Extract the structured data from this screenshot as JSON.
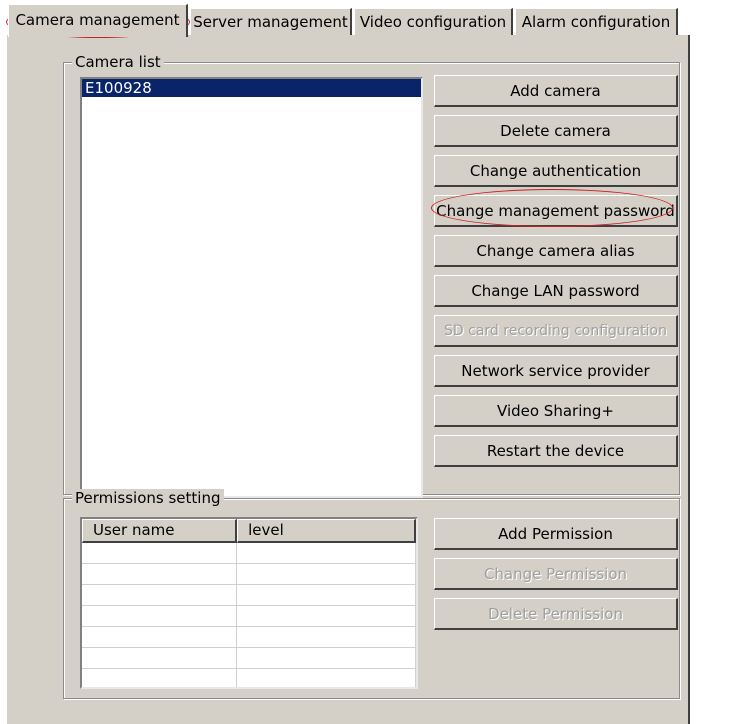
{
  "tabs": [
    {
      "label": "Camera management",
      "active": true
    },
    {
      "label": "Server management",
      "active": false
    },
    {
      "label": "Video configuration",
      "active": false
    },
    {
      "label": "Alarm configuration",
      "active": false
    }
  ],
  "camera_list": {
    "title": "Camera list",
    "items": [
      {
        "label": "E100928",
        "selected": true
      }
    ],
    "buttons": [
      {
        "label": "Add camera",
        "enabled": true
      },
      {
        "label": "Delete camera",
        "enabled": true
      },
      {
        "label": "Change authentication",
        "enabled": true
      },
      {
        "label": "Change management password",
        "enabled": true
      },
      {
        "label": "Change camera alias",
        "enabled": true
      },
      {
        "label": "Change LAN password",
        "enabled": true
      },
      {
        "label": "SD card recording configuration",
        "enabled": false
      },
      {
        "label": "Network service provider",
        "enabled": true
      },
      {
        "label": "Video Sharing+",
        "enabled": true
      },
      {
        "label": "Restart the device",
        "enabled": true
      }
    ]
  },
  "permissions": {
    "title": "Permissions setting",
    "columns": [
      "User name",
      "level"
    ],
    "buttons": [
      {
        "label": "Add Permission",
        "enabled": true
      },
      {
        "label": "Change Permission",
        "enabled": false
      },
      {
        "label": "Delete Permission",
        "enabled": false
      }
    ]
  },
  "colors": {
    "highlight": "#0a246a",
    "annotation": "#cc2020",
    "face": "#d4d0c8"
  }
}
